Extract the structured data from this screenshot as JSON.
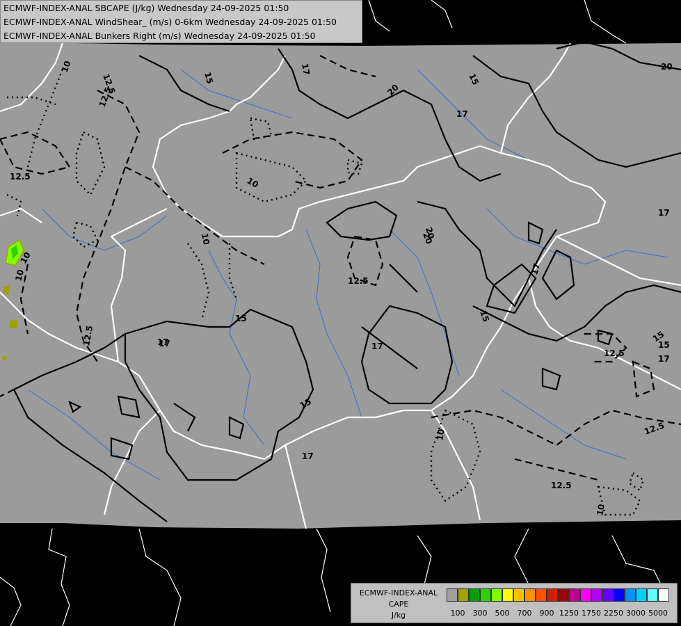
{
  "header": {
    "line1": "ECMWF-INDEX-ANAL SBCAPE (J/kg) Wednesday 24-09-2025 01:50",
    "line2": "ECMWF-INDEX-ANAL WindShear_ (m/s) 0-6km Wednesday 24-09-2025 01:50",
    "line3": "ECMWF-INDEX-ANAL Bunkers Right (m/s) Wednesday 24-09-2025 01:50"
  },
  "legend": {
    "title1": "ECMWF-INDEX-ANAL",
    "title2": "CAPE",
    "title3": "J/kg",
    "swatches": [
      "#a0a0a0",
      "#a0a000",
      "#00a000",
      "#30d000",
      "#80ff00",
      "#ffff00",
      "#ffc000",
      "#ff9000",
      "#ff5000",
      "#d02000",
      "#a00000",
      "#c00090",
      "#ff00ff",
      "#b000ff",
      "#6000ff",
      "#0000ff",
      "#0090ff",
      "#00d0ff",
      "#60ffff",
      "#ffffff"
    ],
    "ticks": [
      "100",
      "300",
      "500",
      "700",
      "900",
      "1250",
      "1750",
      "2250",
      "3000",
      "5000"
    ]
  },
  "contour_labels": [
    "10",
    "12.5",
    "15",
    "17",
    "20",
    "12.5",
    "17",
    "10",
    "12.5",
    "15",
    "20",
    "17",
    "15",
    "10",
    "17",
    "12.5",
    "17",
    "15",
    "12.5",
    "17",
    "15",
    "12.5",
    "10",
    "12.5",
    "10",
    "17",
    "15",
    "15",
    "17",
    "12.5",
    "10",
    "10",
    "17",
    "20",
    "20"
  ],
  "colors": {
    "land_shade": "#9b9b9b",
    "background": "#000000",
    "borders": "#ffffff",
    "rivers": "#3a6ec8",
    "contours": "#000000"
  }
}
